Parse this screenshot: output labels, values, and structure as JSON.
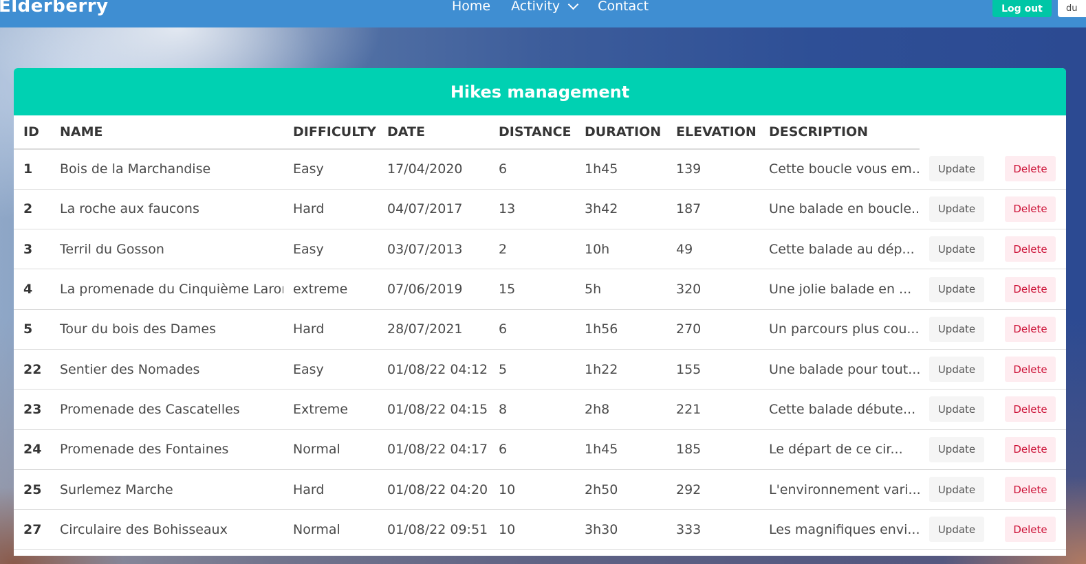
{
  "navbar": {
    "brand": "Elderberry",
    "links": [
      "Home",
      "Activity",
      "Contact"
    ],
    "logout_label": "Log out",
    "user_label": "du"
  },
  "card": {
    "title": "Hikes management"
  },
  "table": {
    "headers": [
      "ID",
      "NAME",
      "DIFFICULTY",
      "DATE",
      "DISTANCE",
      "DURATION",
      "ELEVATION",
      "DESCRIPTION"
    ],
    "update_label": "Update",
    "delete_label": "Delete",
    "rows": [
      {
        "id": "1",
        "name": "Bois de la Marchandise",
        "difficulty": "Easy",
        "date": "17/04/2020",
        "distance": "6",
        "duration": "1h45",
        "elevation": "139",
        "description": "Cette boucle vous em..."
      },
      {
        "id": "2",
        "name": "La roche aux faucons",
        "difficulty": "Hard",
        "date": "04/07/2017",
        "distance": "13",
        "duration": "3h42",
        "elevation": "187",
        "description": "Une balade en boucle..."
      },
      {
        "id": "3",
        "name": "Terril du Gosson",
        "difficulty": "Easy",
        "date": "03/07/2013",
        "distance": "2",
        "duration": "10h",
        "elevation": "49",
        "description": "Cette balade au dép..."
      },
      {
        "id": "4",
        "name": "La promenade du Cinquième Laron",
        "difficulty": "extreme",
        "date": "07/06/2019",
        "distance": "15",
        "duration": "5h",
        "elevation": "320",
        "description": "Une jolie balade en ..."
      },
      {
        "id": "5",
        "name": "Tour du bois des Dames",
        "difficulty": "Hard",
        "date": "28/07/2021",
        "distance": "6",
        "duration": "1h56",
        "elevation": "270",
        "description": "Un parcours plus cou..."
      },
      {
        "id": "22",
        "name": "Sentier des Nomades",
        "difficulty": "Easy",
        "date": "01/08/22 04:12",
        "distance": "5",
        "duration": "1h22",
        "elevation": "155",
        "description": "Une balade pour tout..."
      },
      {
        "id": "23",
        "name": "Promenade des Cascatelles",
        "difficulty": "Extreme",
        "date": "01/08/22 04:15",
        "distance": "8",
        "duration": "2h8",
        "elevation": "221",
        "description": "Cette balade débute..."
      },
      {
        "id": "24",
        "name": "Promenade des Fontaines",
        "difficulty": "Normal",
        "date": "01/08/22 04:17",
        "distance": "6",
        "duration": "1h45",
        "elevation": "185",
        "description": "Le départ de ce cir..."
      },
      {
        "id": "25",
        "name": "Surlemez Marche",
        "difficulty": "Hard",
        "date": "01/08/22 04:20",
        "distance": "10",
        "duration": "2h50",
        "elevation": "292",
        "description": "L'environnement vari..."
      },
      {
        "id": "27",
        "name": "Circulaire des Bohisseaux",
        "difficulty": "Normal",
        "date": "01/08/22 09:51",
        "distance": "10",
        "duration": "3h30",
        "elevation": "333",
        "description": "Les magnifiques envi..."
      }
    ]
  }
}
